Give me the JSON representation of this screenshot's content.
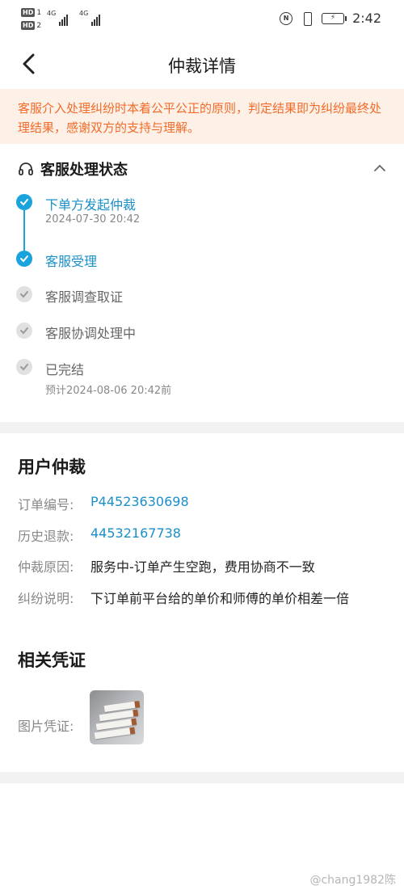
{
  "status_bar": {
    "sim1_badge": "HD",
    "sim1_num": "1",
    "sim2_badge": "HD",
    "sim2_num": "2",
    "net1": "4G",
    "net2": "4G",
    "battery_label": "⚡",
    "nfc_label": "N",
    "time": "2:42"
  },
  "nav": {
    "title": "仲裁详情",
    "back_icon": "back-arrow-icon"
  },
  "notice": {
    "text": "客服介入处理纠纷时本着公平公正的原则，判定结果即为纠纷最终处理结果，感谢双方的支持与理解。",
    "color": "#f26b2a",
    "background": "#fdf1e7"
  },
  "status_section": {
    "title": "客服处理状态",
    "icon": "headset-icon",
    "collapse_icon": "chevron-up-icon",
    "steps": [
      {
        "label": "下单方发起仲裁",
        "sub": "2024-07-30 20:42",
        "state": "done"
      },
      {
        "label": "客服受理",
        "sub": "",
        "state": "done"
      },
      {
        "label": "客服调查取证",
        "sub": "",
        "state": "pending"
      },
      {
        "label": "客服协调处理中",
        "sub": "",
        "state": "pending"
      },
      {
        "label": "已完结",
        "sub": "预计2024-08-06 20:42前",
        "state": "pending"
      }
    ],
    "accent": "#1aa3dc"
  },
  "arbitration": {
    "title": "用户仲裁",
    "rows": [
      {
        "label": "订单编号:",
        "value": "P44523630698"
      },
      {
        "label": "历史退款:",
        "value": "44532167738"
      },
      {
        "label": "仲裁原因:",
        "value": "服务中-订单产生空跑，费用协商不一致"
      },
      {
        "label": "纠纷说明:",
        "value": "下订单前平台给的单价和师傅的单价相差一倍"
      }
    ]
  },
  "evidence": {
    "title": "相关凭证",
    "image_label": "图片凭证:"
  },
  "watermark": "@chang1982陈"
}
